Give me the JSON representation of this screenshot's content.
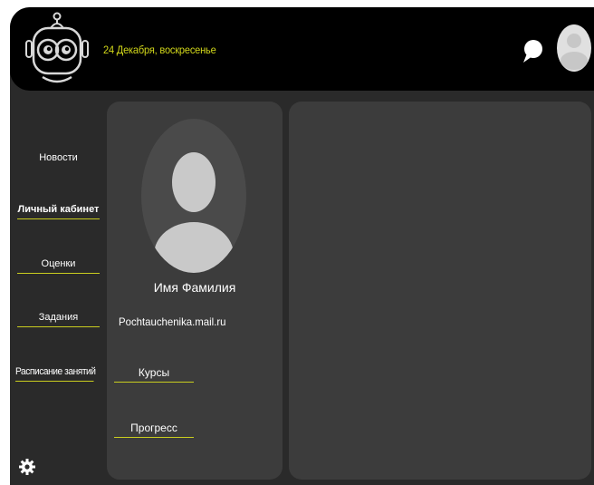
{
  "header": {
    "date": "24 Декабря, воскресенье",
    "logo_icon": "robot-logo-icon",
    "chat_icon": "chat-bubble-icon",
    "avatar_icon": "user-avatar-icon"
  },
  "sidebar": {
    "items": [
      {
        "label": "Новости",
        "active": false
      },
      {
        "label": "Личный кабинет",
        "active": true
      },
      {
        "label": "Оценки",
        "active": false
      },
      {
        "label": "Задания",
        "active": false
      },
      {
        "label": "Расписание занятий",
        "active": false
      }
    ],
    "settings_icon": "gear-icon"
  },
  "profile": {
    "name": "Имя Фамилия",
    "email": "Pochtauchenika.mail.ru",
    "links": [
      "Курсы",
      "Прогресс"
    ]
  },
  "colors": {
    "accent": "#d2d71a",
    "background": "#2a2a2a",
    "panel": "#3c3c3c",
    "header": "#000000"
  }
}
